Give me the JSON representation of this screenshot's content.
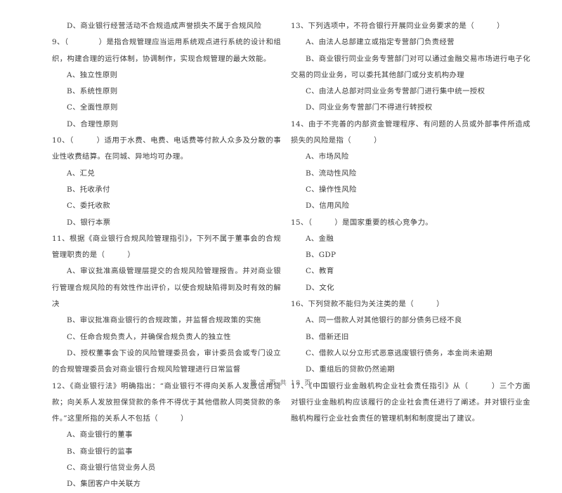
{
  "document": {
    "type": "exam-paper",
    "language": "zh-CN",
    "background_color": "#ffffff",
    "text_color": "#3a3a3a"
  },
  "footer": {
    "text": "第 2 页 共 18 页",
    "current_page": "2",
    "total_pages": "18"
  },
  "left_column": {
    "orphan_option": {
      "label": "D、商业银行经营活动不合规造成声誉损失不属于合规风险"
    },
    "questions": [
      {
        "number": "9、",
        "stem": "9、（　　　　）是指合规管理应当运用系统观点进行系统的设计和组织，构建合理的运行体制，协调制作，实现合规管理的最大效能。",
        "options": [
          "A、独立性原则",
          "B、系统性原则",
          "C、全面性原则",
          "D、合理性原则"
        ]
      },
      {
        "number": "10、",
        "stem": "10、（　　　）适用于水费、电费、电话费等付款人众多及分散的事业性收费结算。在同城、异地均可办理。",
        "options": [
          "A、汇兑",
          "B、托收承付",
          "C、委托收款",
          "D、银行本票"
        ]
      },
      {
        "number": "11、",
        "stem": "11、根据《商业银行合规风险管理指引》，下列不属于董事会的合规管理职责的是（　　　）",
        "options": [
          "A、审议批准高级管理层提交的合规风险管理报告。并对商业银行管理合规风险的有效性作出评价，以使合规缺陷得到及时有效的解决",
          "B、审议批准商业银行的合规政策，并监督合规政策的实施",
          "C、任命合规负责人，并确保合规负责人的独立性",
          "D、授权董事会下设的风险管理委员会，审计委员会或专门设立的合规管理委员会对商业银行合规风险管理进行日常监督"
        ]
      },
      {
        "number": "12、",
        "stem": "12、《商业银行法》明确指出：“商业银行不得向关系人发放信用贷款；向关系人发放担保贷款的条件不得优于其他借款人同类贷款的条件。”这里所指的关系人不包括（　　　）",
        "options": [
          "A、商业银行的董事",
          "B、商业银行的监事",
          "C、商业银行信贷业务人员",
          "D、集团客户中关联方"
        ]
      }
    ]
  },
  "right_column": {
    "questions": [
      {
        "number": "13、",
        "stem": "13、下列选项中，不符合银行开展同业业务要求的是（　　　）",
        "options": [
          "A、由法人总部建立或指定专营部门负责经营",
          "B、商业银行同业业务专营部门对可以通过金融交易市场进行电子化交易的同业业务，可以委托其他部门或分支机构办理",
          "C、由法人总部对同业业务专营部门进行集中统一授权",
          "D、同业业务专营部门不得进行转授权"
        ]
      },
      {
        "number": "14、",
        "stem": "14、由于不完善的内部资金管理程序、有问题的人员或外部事件所造成损失的风险是指（　　　）",
        "options": [
          "A、市场风险",
          "B、流动性风险",
          "C、操作性风险",
          "D、信用风险"
        ]
      },
      {
        "number": "15、",
        "stem": "15、（　　　）是国家重要的核心竞争力。",
        "options": [
          "A、金融",
          "B、GDP",
          "C、教育",
          "D、文化"
        ]
      },
      {
        "number": "16、",
        "stem": "16、下列贷款不能归为关注类的是（　　　）",
        "options": [
          "A、同一借款人对其他银行的部分债务已经不良",
          "B、借新还旧",
          "C、借款人以分立形式恶意逃废银行债务，本金尚未逾期",
          "D、重组后的贷款仍然逾期"
        ]
      },
      {
        "number": "17、",
        "stem": "17、《中国银行业金融机构企业社会责任指引》从（　　　）三个方面对银行业金融机构应该履行的企业社会责任进行了阐述。并对银行业金融机构履行企业社会责任的管理机制和制度提出了建议。",
        "options": []
      }
    ]
  }
}
